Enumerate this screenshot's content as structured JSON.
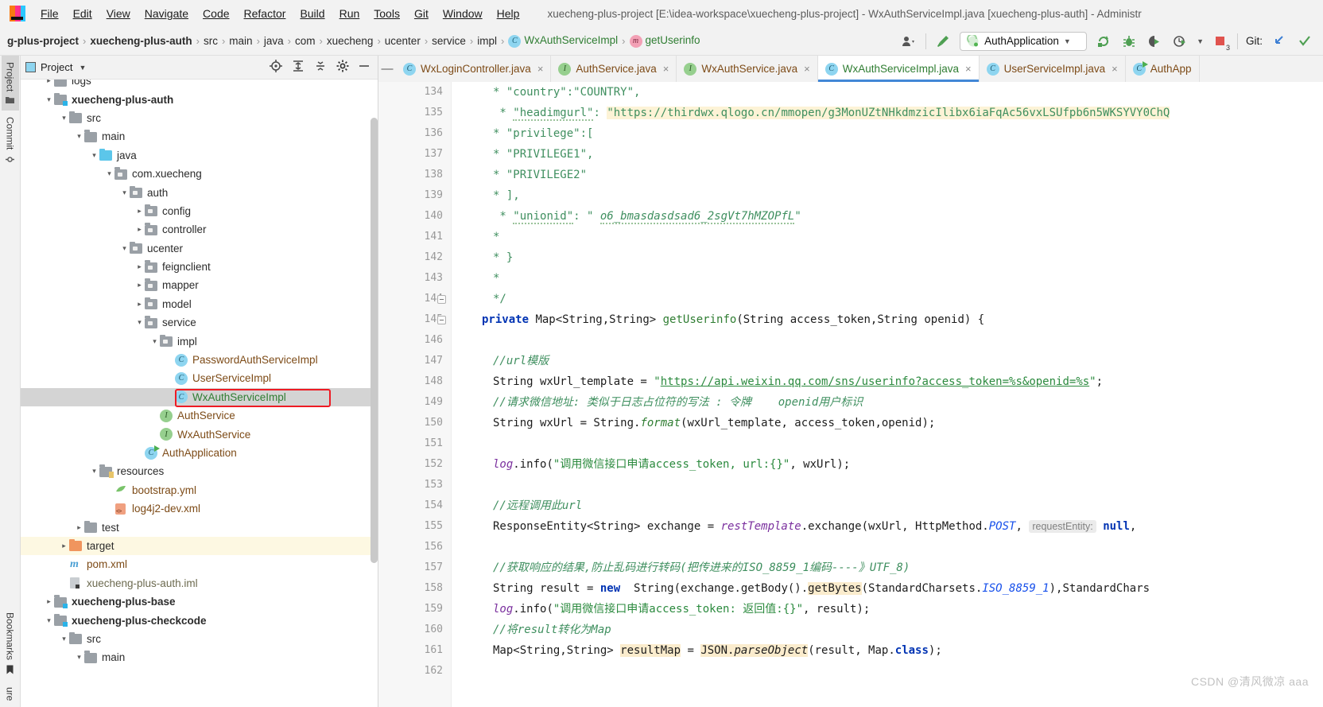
{
  "window": {
    "title": "xuecheng-plus-project [E:\\idea-workspace\\xuecheng-plus-project] - WxAuthServiceImpl.java [xuecheng-plus-auth] - Administr"
  },
  "menubar": {
    "items": [
      {
        "label": "File"
      },
      {
        "label": "Edit"
      },
      {
        "label": "View"
      },
      {
        "label": "Navigate"
      },
      {
        "label": "Code"
      },
      {
        "label": "Refactor"
      },
      {
        "label": "Build"
      },
      {
        "label": "Run"
      },
      {
        "label": "Tools"
      },
      {
        "label": "Git"
      },
      {
        "label": "Window"
      },
      {
        "label": "Help"
      }
    ]
  },
  "navbar": {
    "breadcrumbs": [
      {
        "label": "g-plus-project",
        "style": "bold"
      },
      {
        "label": "xuecheng-plus-auth",
        "style": "bold"
      },
      {
        "label": "src",
        "style": "plain"
      },
      {
        "label": "main",
        "style": "plain"
      },
      {
        "label": "java",
        "style": "plain"
      },
      {
        "label": "com",
        "style": "plain"
      },
      {
        "label": "xuecheng",
        "style": "plain"
      },
      {
        "label": "ucenter",
        "style": "plain"
      },
      {
        "label": "service",
        "style": "plain"
      },
      {
        "label": "impl",
        "style": "plain"
      },
      {
        "label": "WxAuthServiceImpl",
        "style": "green",
        "icon": "class-icon"
      },
      {
        "label": "getUserinfo",
        "style": "green",
        "icon": "method-icon"
      }
    ],
    "run_configuration": "AuthApplication",
    "git_label": "Git:",
    "icons": [
      "user-icon",
      "hammer-icon",
      "rerun-icon",
      "debug-icon",
      "run-with-coverage-icon",
      "profile-icon",
      "stop-icon",
      "git-update-icon",
      "git-commit-icon"
    ],
    "error_count": "3"
  },
  "rail": {
    "left": [
      {
        "label": "Project",
        "active": true,
        "icon": "folder-icon"
      },
      {
        "label": "Commit",
        "active": false,
        "icon": "commit-icon"
      }
    ],
    "left_bottom": [
      {
        "label": "Bookmarks",
        "icon": "bookmark-icon"
      },
      {
        "label": "ure",
        "icon": "structure-icon"
      }
    ]
  },
  "project_panel": {
    "title": "Project",
    "actions": [
      "locate-icon",
      "expand-all-icon",
      "collapse-all-icon",
      "settings-gear-icon",
      "hide-icon"
    ],
    "tree": [
      {
        "indent": 1,
        "arrow": "right",
        "icon": "folder-plain",
        "label": "logs",
        "style": "plain",
        "state": "clipped"
      },
      {
        "indent": 1,
        "arrow": "down",
        "icon": "folder-module",
        "label": "xuecheng-plus-auth",
        "style": "bold"
      },
      {
        "indent": 2,
        "arrow": "down",
        "icon": "folder-plain",
        "label": "src",
        "style": "plain"
      },
      {
        "indent": 3,
        "arrow": "down",
        "icon": "folder-plain",
        "label": "main",
        "style": "plain"
      },
      {
        "indent": 4,
        "arrow": "down",
        "icon": "folder-source",
        "label": "java",
        "style": "plain"
      },
      {
        "indent": 5,
        "arrow": "down",
        "icon": "folder-package",
        "label": "com.xuecheng",
        "style": "plain"
      },
      {
        "indent": 6,
        "arrow": "down",
        "icon": "folder-package",
        "label": "auth",
        "style": "plain"
      },
      {
        "indent": 7,
        "arrow": "right",
        "icon": "folder-package",
        "label": "config",
        "style": "plain"
      },
      {
        "indent": 7,
        "arrow": "right",
        "icon": "folder-package",
        "label": "controller",
        "style": "plain"
      },
      {
        "indent": 6,
        "arrow": "down",
        "icon": "folder-package",
        "label": "ucenter",
        "style": "plain"
      },
      {
        "indent": 7,
        "arrow": "right",
        "icon": "folder-package",
        "label": "feignclient",
        "style": "plain"
      },
      {
        "indent": 7,
        "arrow": "right",
        "icon": "folder-package",
        "label": "mapper",
        "style": "plain"
      },
      {
        "indent": 7,
        "arrow": "right",
        "icon": "folder-package",
        "label": "model",
        "style": "plain"
      },
      {
        "indent": 7,
        "arrow": "down",
        "icon": "folder-package",
        "label": "service",
        "style": "plain"
      },
      {
        "indent": 8,
        "arrow": "down",
        "icon": "folder-package",
        "label": "impl",
        "style": "plain"
      },
      {
        "indent": 9,
        "arrow": "none",
        "icon": "class-icon",
        "label": "PasswordAuthServiceImpl",
        "style": "brown"
      },
      {
        "indent": 9,
        "arrow": "none",
        "icon": "class-icon",
        "label": "UserServiceImpl",
        "style": "brown"
      },
      {
        "indent": 9,
        "arrow": "none",
        "icon": "class-icon",
        "label": "WxAuthServiceImpl",
        "style": "green",
        "selected": true,
        "annotated": true
      },
      {
        "indent": 8,
        "arrow": "none",
        "icon": "interface-icon",
        "label": "AuthService",
        "style": "brown"
      },
      {
        "indent": 8,
        "arrow": "none",
        "icon": "interface-icon",
        "label": "WxAuthService",
        "style": "brown"
      },
      {
        "indent": 7,
        "arrow": "none",
        "icon": "runnable-class-icon",
        "label": "AuthApplication",
        "style": "brown"
      },
      {
        "indent": 4,
        "arrow": "down",
        "icon": "folder-resources",
        "label": "resources",
        "style": "plain"
      },
      {
        "indent": 5,
        "arrow": "none",
        "icon": "yml-icon",
        "label": "bootstrap.yml",
        "style": "brown"
      },
      {
        "indent": 5,
        "arrow": "none",
        "icon": "xml-icon",
        "label": "log4j2-dev.xml",
        "style": "brown"
      },
      {
        "indent": 3,
        "arrow": "right",
        "icon": "folder-plain",
        "label": "test",
        "style": "plain"
      },
      {
        "indent": 2,
        "arrow": "right",
        "icon": "folder-target",
        "label": "target",
        "style": "plain",
        "highlight": true
      },
      {
        "indent": 2,
        "arrow": "none",
        "icon": "maven-icon",
        "label": "pom.xml",
        "style": "brown"
      },
      {
        "indent": 2,
        "arrow": "none",
        "icon": "iml-icon",
        "label": "xuecheng-plus-auth.iml",
        "style": "gray"
      },
      {
        "indent": 1,
        "arrow": "right",
        "icon": "folder-module",
        "label": "xuecheng-plus-base",
        "style": "bold"
      },
      {
        "indent": 1,
        "arrow": "down",
        "icon": "folder-module",
        "label": "xuecheng-plus-checkcode",
        "style": "bold"
      },
      {
        "indent": 2,
        "arrow": "down",
        "icon": "folder-plain",
        "label": "src",
        "style": "plain"
      },
      {
        "indent": 3,
        "arrow": "down",
        "icon": "folder-plain",
        "label": "main",
        "style": "plain"
      }
    ]
  },
  "editor": {
    "tabs": [
      {
        "label": "WxLoginController.java",
        "icon": "class-icon",
        "active": false,
        "close": "×"
      },
      {
        "label": "AuthService.java",
        "icon": "interface-icon",
        "active": false,
        "close": "×"
      },
      {
        "label": "WxAuthService.java",
        "icon": "interface-icon",
        "active": false,
        "close": "×"
      },
      {
        "label": "WxAuthServiceImpl.java",
        "icon": "class-icon",
        "active": true,
        "close": "×"
      },
      {
        "label": "UserServiceImpl.java",
        "icon": "class-icon",
        "active": false,
        "close": "×"
      },
      {
        "label": "AuthApp",
        "icon": "runnable-class-icon",
        "active": false,
        "close": ""
      }
    ],
    "first_line_number": 134,
    "line_numbers": [
      134,
      135,
      136,
      137,
      138,
      139,
      140,
      141,
      142,
      143,
      144,
      145,
      146,
      147,
      148,
      149,
      150,
      151,
      152,
      153,
      154,
      155,
      156,
      157,
      158,
      159,
      160,
      161,
      162
    ],
    "code_lines": [
      {
        "n": 134,
        "text": " * \"country\":\"COUNTRY\","
      },
      {
        "n": 135,
        "text": " * \"headimgurl\": \"https://thirdwx.qlogo.cn/mmopen/g3MonUZtNHkdmzicIlibx6iaFqAc56vxLSUfpb6n5WKSYVY0ChQ"
      },
      {
        "n": 136,
        "text": " * \"privilege\":["
      },
      {
        "n": 137,
        "text": " * \"PRIVILEGE1\","
      },
      {
        "n": 138,
        "text": " * \"PRIVILEGE2\""
      },
      {
        "n": 139,
        "text": " * ],"
      },
      {
        "n": 140,
        "text": " * \"unionid\": \" o6_bmasdasdsad6_2sgVt7hMZOPfL\""
      },
      {
        "n": 141,
        "text": " *"
      },
      {
        "n": 142,
        "text": " * }"
      },
      {
        "n": 143,
        "text": " *"
      },
      {
        "n": 144,
        "text": " */"
      },
      {
        "n": 145,
        "text": "private Map<String,String> getUserinfo(String access_token,String openid) {"
      },
      {
        "n": 146,
        "text": ""
      },
      {
        "n": 147,
        "text": "//url模版"
      },
      {
        "n": 148,
        "text": "String wxUrl_template = \"https://api.weixin.qq.com/sns/userinfo?access_token=%s&openid=%s\";"
      },
      {
        "n": 149,
        "text": "//请求微信地址: 类似于日志占位符的写法 : 令牌    openid用户标识"
      },
      {
        "n": 150,
        "text": "String wxUrl = String.format(wxUrl_template, access_token,openid);"
      },
      {
        "n": 151,
        "text": ""
      },
      {
        "n": 152,
        "text": "log.info(\"调用微信接口申请access_token, url:{}\", wxUrl);"
      },
      {
        "n": 153,
        "text": ""
      },
      {
        "n": 154,
        "text": "//远程调用此url"
      },
      {
        "n": 155,
        "text": "ResponseEntity<String> exchange = restTemplate.exchange(wxUrl, HttpMethod.POST,  requestEntity: null,"
      },
      {
        "n": 156,
        "text": ""
      },
      {
        "n": 157,
        "text": "//获取响应的结果,防止乱码进行转码(把传进来的ISO_8859_1编码----》UTF_8)"
      },
      {
        "n": 158,
        "text": "String result = new  String(exchange.getBody().getBytes(StandardCharsets.ISO_8859_1),StandardChars"
      },
      {
        "n": 159,
        "text": "log.info(\"调用微信接口申请access_token: 返回值:{}\", result);"
      },
      {
        "n": 160,
        "text": "//将result转化为Map"
      },
      {
        "n": 161,
        "text": "Map<String,String> resultMap = JSON.parseObject(result, Map.class);"
      },
      {
        "n": 162,
        "text": ""
      }
    ],
    "inlay_hint": "requestEntity:",
    "watermark": "CSDN @清风微凉 aaa"
  },
  "colors": {
    "accent": "#4287d6",
    "annotation": "#ee1b24",
    "comment": "#3f8f5f",
    "string": "#2b8a3e",
    "keyword": "#0033b3",
    "highlight": "#fdf3d6"
  }
}
